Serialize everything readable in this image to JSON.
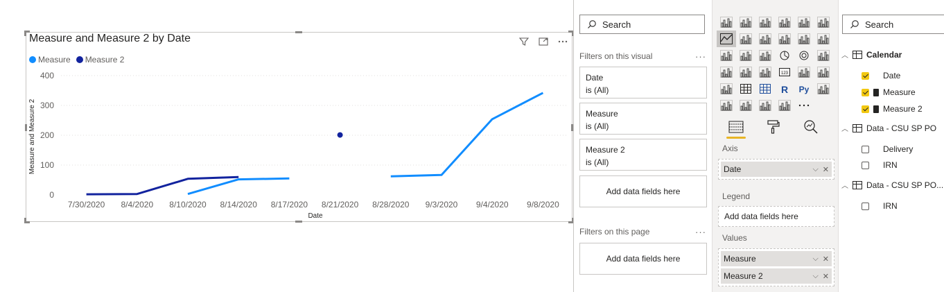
{
  "visual": {
    "title": "Measure and Measure 2 by Date"
  },
  "chart_data": {
    "type": "line",
    "title": "Measure and Measure 2 by Date",
    "xlabel": "Date",
    "ylabel": "Measure and Measure 2",
    "ylim": [
      0,
      400
    ],
    "yticks": [
      "0",
      "100",
      "200",
      "300",
      "400"
    ],
    "grid": true,
    "legend_position": "top-left",
    "categories": [
      "7/30/2020",
      "8/4/2020",
      "8/10/2020",
      "8/14/2020",
      "8/17/2020",
      "8/21/2020",
      "8/28/2020",
      "9/3/2020",
      "9/4/2020",
      "9/8/2020"
    ],
    "series": [
      {
        "name": "Measure",
        "color": "#118DFF",
        "points": [
          {
            "date": "8/10/2020",
            "value": 3
          },
          {
            "date": "8/14/2020",
            "value": 52
          },
          {
            "date": "8/17/2020",
            "value": 55
          },
          {
            "date": "8/28/2020",
            "value": 62
          },
          {
            "date": "9/3/2020",
            "value": 67
          },
          {
            "date": "9/4/2020",
            "value": 254
          },
          {
            "date": "9/8/2020",
            "value": 342
          }
        ],
        "segments": [
          [
            0,
            2
          ],
          [
            3,
            6
          ]
        ]
      },
      {
        "name": "Measure 2",
        "color": "#12239E",
        "points": [
          {
            "date": "7/30/2020",
            "value": 2
          },
          {
            "date": "8/4/2020",
            "value": 3
          },
          {
            "date": "8/10/2020",
            "value": 54
          },
          {
            "date": "8/14/2020",
            "value": 60
          },
          {
            "date": "8/21/2020",
            "value": 201
          }
        ],
        "segments": [
          [
            0,
            3
          ],
          [
            4,
            4
          ]
        ]
      }
    ]
  },
  "filters": {
    "search_placeholder": "Search",
    "on_visual_label": "Filters on this visual",
    "visual_cards": [
      {
        "name": "Date",
        "state": "is (All)"
      },
      {
        "name": "Measure",
        "state": "is (All)"
      },
      {
        "name": "Measure 2",
        "state": "is (All)"
      }
    ],
    "add_fields_label": "Add data fields here",
    "on_page_label": "Filters on this page",
    "page_add_label": "Add data fields here"
  },
  "visualizations": {
    "axis_label": "Axis",
    "axis_field": "Date",
    "legend_label": "Legend",
    "legend_placeholder": "Add data fields here",
    "values_label": "Values",
    "values_fields": [
      "Measure",
      "Measure 2"
    ],
    "more_label": "···"
  },
  "fields": {
    "search_placeholder": "Search",
    "tables": [
      {
        "name": "Calendar",
        "items": [
          "Date",
          "Measure",
          "Measure 2"
        ]
      },
      {
        "name": "Data - CSU SP PO",
        "items": [
          "Delivery",
          "IRN"
        ]
      },
      {
        "name": "Data - CSU SP PO...",
        "items": [
          "IRN"
        ]
      }
    ]
  },
  "colors": {
    "measure": "#118DFF",
    "measure2": "#12239E",
    "accent": "#E8B525"
  }
}
